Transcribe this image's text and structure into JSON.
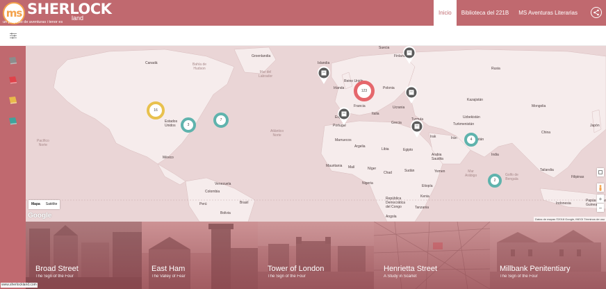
{
  "brand": {
    "mark": "ms",
    "name": "SHERLOCK",
    "suffix": "land",
    "tagline": "un proyecto de aventuras i tenor es"
  },
  "nav": {
    "items": [
      {
        "label": "Inicio",
        "active": true
      },
      {
        "label": "Biblioteca del 221B",
        "active": false
      },
      {
        "label": "MS Aventuras Literarias",
        "active": false
      }
    ]
  },
  "map": {
    "countries": {
      "canada": "Canadá",
      "usa": "Estados\nUnidos",
      "mexico": "México",
      "venezuela": "Venezuela",
      "colombia": "Colombia",
      "peru": "Perú",
      "brasil": "Brasil",
      "bolivia": "Bolivia",
      "greenland": "Groenlandia",
      "iceland": "Islandia",
      "suecia": "Suecia",
      "finlandia": "Finlandia",
      "irlanda": "Irlanda",
      "reino_unido": "Reino Unido",
      "polonia": "Polonia",
      "francia": "Francia",
      "ucrania": "Ucrania",
      "italia": "Italia",
      "espana": "España",
      "portugal": "Portugal",
      "grecia": "Grecia",
      "turquia": "Turquía",
      "rusia": "Rusia",
      "kazajistan": "Kazajistán",
      "mongolia": "Mongolia",
      "china": "China",
      "japon": "Japón",
      "uzbekistan": "Uzbekistán",
      "turkmenistan": "Turkmenistán",
      "iran": "Irán",
      "irak": "Irak",
      "pakistan": "Pakistán",
      "india": "India",
      "arabia": "Arabia\nSaudita",
      "yemen": "Yemen",
      "marruecos": "Marruecos",
      "argelia": "Argelia",
      "libia": "Libia",
      "egipto": "Egipto",
      "mauritania": "Mauritania",
      "mali": "Malí",
      "niger": "Níger",
      "chad": "Chad",
      "sudan": "Sudán",
      "nigeria": "Nigeria",
      "etiopia": "Etiopía",
      "kenia": "Kenia",
      "tanzania": "Tanzania",
      "rdc": "República\nDemocrática\ndel Congo",
      "angola": "Angola",
      "tailandia": "Tailandia",
      "filipinas": "Filipinas",
      "indonesia": "Indonesia",
      "papua": "Papúa Nueva\nGuinea"
    },
    "oceans": {
      "atlantic_n": "Atlántico\nNorte",
      "pacific_n": "Pacífico\nNorte",
      "labrador": "Mar del\nLabrador",
      "hudson": "Bahía de\nHudson",
      "bengal": "Golfo de\nBengala",
      "arabian": "Mar\nArábigo"
    },
    "clusters": [
      {
        "count": "16",
        "color": "yellow"
      },
      {
        "count": "3",
        "color": "teal"
      },
      {
        "count": "7",
        "color": "teal"
      },
      {
        "count": "123",
        "color": "red"
      },
      {
        "count": "4",
        "color": "teal"
      },
      {
        "count": "2",
        "color": "teal"
      }
    ],
    "maptype": {
      "map": "Mapa",
      "satellite": "Satélite"
    },
    "google": "Google",
    "attribution": "Datos de mapas ©2018 Google, INEGI   Términos de uso",
    "zoom_in": "+",
    "zoom_out": "−"
  },
  "cards": [
    {
      "title": "Broad Street",
      "subtitle": "The Sign of the Four"
    },
    {
      "title": "East Ham",
      "subtitle": "The Valley of Fear"
    },
    {
      "title": "Tower of London",
      "subtitle": "The Sign of the Four"
    },
    {
      "title": "Henrietta Street",
      "subtitle": "A Study in Scarlet"
    },
    {
      "title": "Millbank Penitentiary",
      "subtitle": "The Sign of the Four"
    }
  ],
  "footer": {
    "url": "www.sherlockland.com"
  },
  "colors": {
    "brand": "#c0696f",
    "accent": "#f4a24b",
    "cluster_red": "#e5676c",
    "cluster_teal": "#5fb3ad",
    "cluster_yellow": "#e8c14e"
  }
}
